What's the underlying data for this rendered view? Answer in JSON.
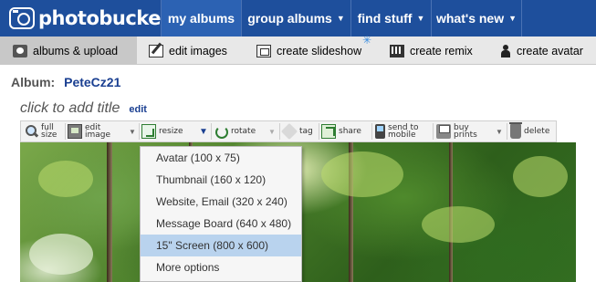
{
  "brand": {
    "logo_text": "photobucket"
  },
  "topnav": [
    {
      "label": "my albums",
      "active": true,
      "caret": ""
    },
    {
      "label": "group albums",
      "active": false,
      "caret": "▼"
    },
    {
      "label": "find stuff",
      "active": false,
      "caret": "▼"
    },
    {
      "label": "what's new",
      "active": false,
      "caret": "▼"
    }
  ],
  "subnav": [
    {
      "label": "albums & upload",
      "icon": "upload-icon",
      "active": true
    },
    {
      "label": "edit images",
      "icon": "edit-images-icon",
      "active": false
    },
    {
      "label": "create slideshow",
      "icon": "slideshow-icon",
      "active": false,
      "badge": "✳"
    },
    {
      "label": "create remix",
      "icon": "remix-icon",
      "active": false
    },
    {
      "label": "create avatar",
      "icon": "avatar-icon",
      "active": false
    }
  ],
  "album": {
    "label": "Album:",
    "name": "PeteCz21"
  },
  "photo_title": {
    "placeholder": "click to add title",
    "edit_label": "edit"
  },
  "toolbar": {
    "full_size": [
      "full",
      "size"
    ],
    "edit_image": [
      "edit",
      "image"
    ],
    "resize": "resize",
    "rotate": "rotate",
    "tag": "tag",
    "share": "share",
    "send_to_mobile": [
      "send to",
      "mobile"
    ],
    "buy_prints": [
      "buy",
      "prints"
    ],
    "delete": "delete"
  },
  "resize_menu": {
    "items": [
      "Avatar (100 x 75)",
      "Thumbnail (160 x 120)",
      "Website, Email (320 x 240)",
      "Message Board (640 x 480)",
      "15\" Screen (800 x 600)",
      "More options"
    ],
    "selected_index": 4
  },
  "colors": {
    "topbar": "#1e4f9c",
    "topbar_active": "#2c62b3",
    "album_name": "#1a3f91",
    "menu_selected": "#b9d3ee"
  }
}
